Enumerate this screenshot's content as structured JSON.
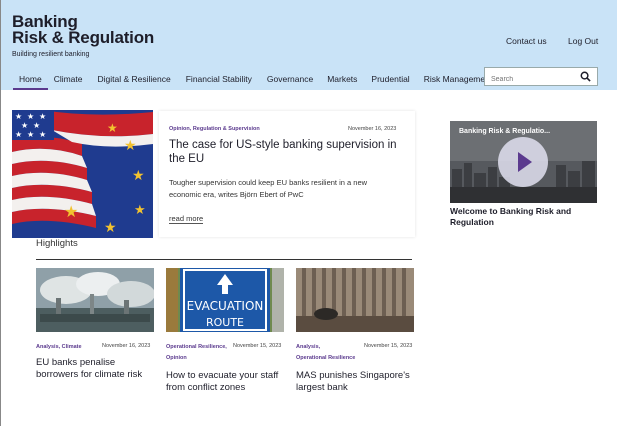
{
  "header": {
    "logo_line1": "Banking",
    "logo_line2": "Risk & Regulation",
    "tagline": "Building resilient banking",
    "contact_label": "Contact us",
    "logout_label": "Log Out"
  },
  "nav": {
    "items": [
      {
        "label": "Home"
      },
      {
        "label": "Climate"
      },
      {
        "label": "Digital & Resilience"
      },
      {
        "label": "Financial Stability"
      },
      {
        "label": "Governance"
      },
      {
        "label": "Markets"
      },
      {
        "label": "Prudential"
      },
      {
        "label": "Risk Management"
      }
    ],
    "active": "Home"
  },
  "search": {
    "placeholder": "Search",
    "icon": "search-icon"
  },
  "featured": {
    "category": "Opinion, Regulation & Supervision",
    "date": "November 16, 2023",
    "title": "The case for US-style banking supervision in the EU",
    "description": "Tougher supervision could keep EU banks resilient in a new economic era, writes Björn Ebert of PwC",
    "read_more": "read more"
  },
  "highlights": {
    "heading": "Highlights",
    "cards": [
      {
        "category": "Analysis, Climate",
        "category2": "",
        "date": "November 16, 2023",
        "title": "EU banks penalise borrowers for climate risk"
      },
      {
        "category": "Operational Resilience,",
        "category2": "Opinion",
        "date": "November 15, 2023",
        "title": "How to evacuate your staff from conflict zones"
      },
      {
        "category": "Analysis,",
        "category2": "Operational Resilience",
        "date": "November 15, 2023",
        "title": "MAS punishes Singapore's largest bank"
      }
    ]
  },
  "video": {
    "overlay_title": "Banking Risk & Regulatio...",
    "caption": "Welcome to Banking Risk and Regulation"
  },
  "colors": {
    "header_bg": "#c9e3f7",
    "accent": "#5b3a8e"
  }
}
